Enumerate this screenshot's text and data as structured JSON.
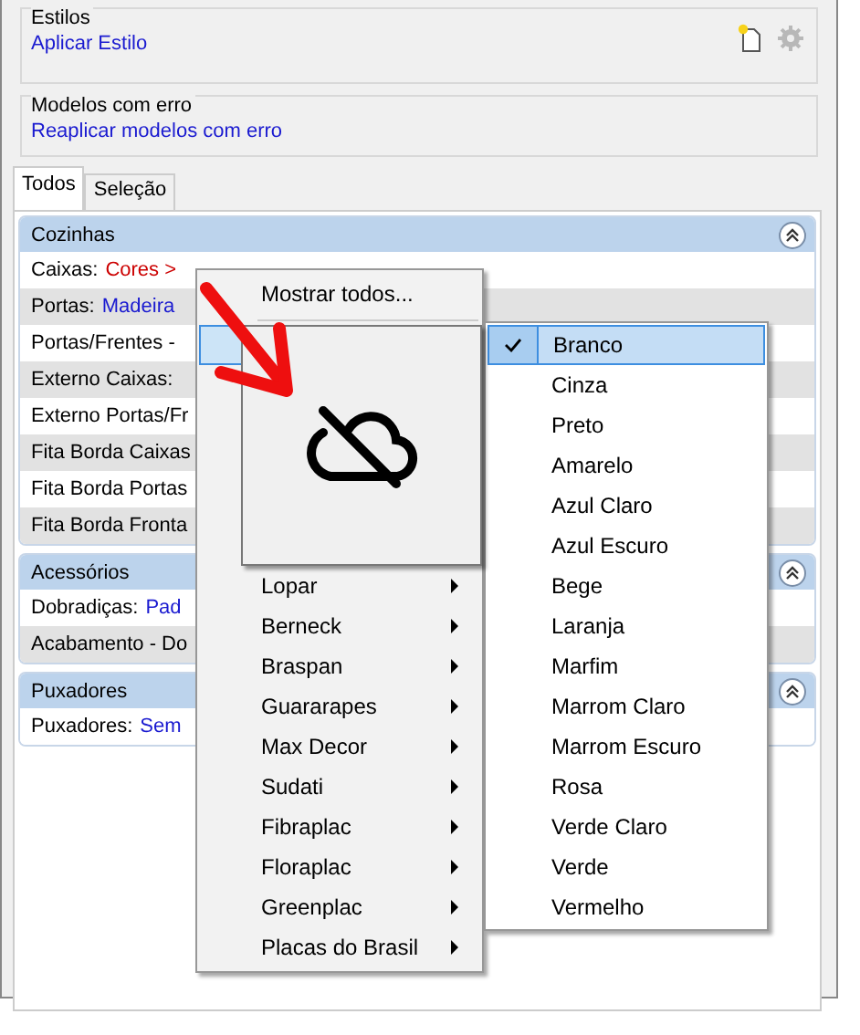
{
  "estilos": {
    "title": "Estilos",
    "link": "Aplicar Estilo"
  },
  "modelos": {
    "title": "Modelos com erro",
    "link": "Reaplicar modelos com erro"
  },
  "tabs": [
    {
      "label": "Todos",
      "selected": true
    },
    {
      "label": "Seleção",
      "selected": false
    }
  ],
  "sections": [
    {
      "title": "Cozinhas",
      "expanded": true,
      "rows": [
        {
          "label": "Caixas:",
          "value": "Cores >",
          "color": "#cc0000"
        },
        {
          "label": "Portas:",
          "value": "Madeira",
          "color": "#1a1ad0"
        },
        {
          "label": "Portas/Frentes -"
        },
        {
          "label": "Externo Caixas:"
        },
        {
          "label": "Externo Portas/Fr"
        },
        {
          "label": "Fita Borda Caixas"
        },
        {
          "label": "Fita Borda Portas"
        },
        {
          "label": "Fita Borda Fronta"
        }
      ]
    },
    {
      "title": "Acessórios",
      "expanded": true,
      "rows": [
        {
          "label": "Dobradiças:",
          "value": "Pad",
          "color": "#1a1ad0"
        },
        {
          "label": "Acabamento - Do"
        }
      ]
    },
    {
      "title": "Puxadores",
      "expanded": true,
      "rows": [
        {
          "label": "Puxadores:",
          "value": "Sem",
          "color": "#1a1ad0"
        }
      ]
    }
  ],
  "menu": [
    {
      "kind": "command",
      "label": "Mostrar todos...",
      "selected": false
    },
    {
      "kind": "separator"
    },
    {
      "kind": "hidden",
      "selected": true
    },
    {
      "kind": "submenu",
      "label": "Lopar",
      "selected": false
    },
    {
      "kind": "submenu",
      "label": "Berneck",
      "selected": false
    },
    {
      "kind": "submenu",
      "label": "Braspan",
      "selected": false
    },
    {
      "kind": "submenu",
      "label": "Guararapes",
      "selected": false
    },
    {
      "kind": "submenu",
      "label": "Max Decor",
      "selected": false
    },
    {
      "kind": "submenu",
      "label": "Sudati",
      "selected": false
    },
    {
      "kind": "submenu",
      "label": "Fibraplac",
      "selected": false
    },
    {
      "kind": "submenu",
      "label": "Floraplac",
      "selected": false
    },
    {
      "kind": "submenu",
      "label": "Greenplac",
      "selected": false
    },
    {
      "kind": "submenu",
      "label": "Placas do Brasil",
      "selected": false
    }
  ],
  "submenu": [
    {
      "label": "Branco",
      "checked": true,
      "selected": true
    },
    {
      "label": "Cinza",
      "checked": false,
      "selected": false
    },
    {
      "label": "Preto",
      "checked": false,
      "selected": false
    },
    {
      "label": "Amarelo",
      "checked": false,
      "selected": false
    },
    {
      "label": "Azul Claro",
      "checked": false,
      "selected": false
    },
    {
      "label": "Azul Escuro",
      "checked": false,
      "selected": false
    },
    {
      "label": "Bege",
      "checked": false,
      "selected": false
    },
    {
      "label": "Laranja",
      "checked": false,
      "selected": false
    },
    {
      "label": "Marfim",
      "checked": false,
      "selected": false
    },
    {
      "label": "Marrom Claro",
      "checked": false,
      "selected": false
    },
    {
      "label": "Marrom Escuro",
      "checked": false,
      "selected": false
    },
    {
      "label": "Rosa",
      "checked": false,
      "selected": false
    },
    {
      "label": "Verde Claro",
      "checked": false,
      "selected": false
    },
    {
      "label": "Verde",
      "checked": false,
      "selected": false
    },
    {
      "label": "Vermelho",
      "checked": false,
      "selected": false
    }
  ]
}
